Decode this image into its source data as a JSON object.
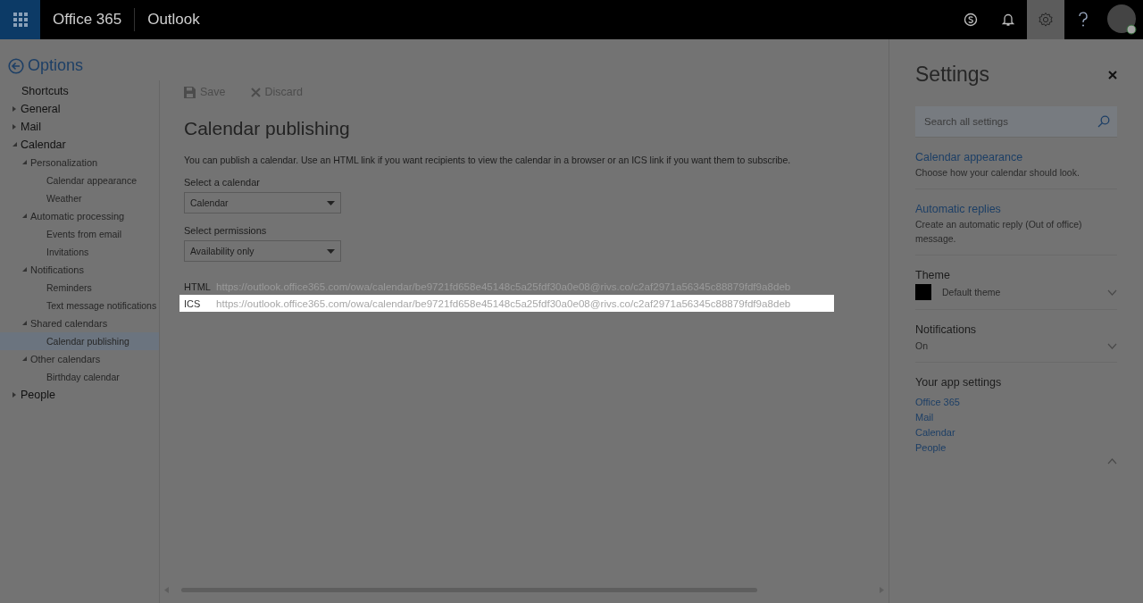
{
  "header": {
    "brand": "Office 365",
    "app": "Outlook",
    "icons": [
      {
        "kind": "skype",
        "selected": false
      },
      {
        "kind": "bell",
        "selected": false
      },
      {
        "kind": "settings",
        "selected": true
      },
      {
        "kind": "help",
        "selected": false
      },
      {
        "kind": "avatar",
        "selected": false
      }
    ]
  },
  "nav": {
    "title": "Options",
    "items": [
      {
        "label": "Shortcuts",
        "selected": false
      },
      {
        "label": "General",
        "expanded": false,
        "selected": false
      },
      {
        "label": "Mail",
        "expanded": false,
        "selected": false
      },
      {
        "label": "Calendar",
        "expanded": true,
        "selected": false,
        "children": [
          {
            "label": "Personalization",
            "expanded": true,
            "selected": false,
            "children": [
              {
                "label": "Calendar appearance",
                "selected": false
              },
              {
                "label": "Weather",
                "selected": false
              }
            ]
          },
          {
            "label": "Automatic processing",
            "expanded": true,
            "selected": false,
            "children": [
              {
                "label": "Events from email",
                "selected": false
              },
              {
                "label": "Invitations",
                "selected": false
              }
            ]
          },
          {
            "label": "Notifications",
            "expanded": true,
            "selected": false,
            "children": [
              {
                "label": "Reminders",
                "selected": false
              },
              {
                "label": "Text message notifications",
                "selected": false
              }
            ]
          },
          {
            "label": "Shared calendars",
            "expanded": true,
            "selected": false,
            "children": [
              {
                "label": "Calendar publishing",
                "selected": true
              }
            ]
          },
          {
            "label": "Other calendars",
            "expanded": true,
            "selected": false,
            "children": [
              {
                "label": "Birthday calendar",
                "selected": false
              }
            ]
          }
        ]
      },
      {
        "label": "People",
        "expanded": false,
        "selected": false
      }
    ]
  },
  "toolbar": [
    {
      "kind": "save",
      "label": "Save"
    },
    {
      "kind": "discard",
      "label": "Discard"
    }
  ],
  "page": {
    "title": "Calendar publishing",
    "description": "You can publish a calendar. Use an HTML link if you want recipients to view the calendar in a browser or an ICS link if you want them to subscribe.",
    "fields": [
      {
        "label": "Select a calendar",
        "value": "Calendar"
      },
      {
        "label": "Select permissions",
        "value": "Availability only"
      }
    ],
    "links": [
      {
        "label": "HTML",
        "url": "https://outlook.office365.com/owa/calendar/be9721fd658e45148c5a25fdf30a0e08@rivs.co/c2af2971a56345c88879fdf9a8deb",
        "selected": false
      },
      {
        "label": "ICS",
        "url": "https://outlook.office365.com/owa/calendar/be9721fd658e45148c5a25fdf30a0e08@rivs.co/c2af2971a56345c88879fdf9a8deb",
        "selected": true
      }
    ]
  },
  "settings": {
    "title": "Settings",
    "search": {
      "placeholder": "Search all settings"
    },
    "sections": [
      {
        "kind": "link",
        "title": "Calendar appearance",
        "text": "Choose how your calendar should look."
      },
      {
        "kind": "link",
        "title": "Automatic replies",
        "text": "Create an automatic reply (Out of office) message."
      },
      {
        "kind": "theme",
        "title": "Theme",
        "value": "Default theme",
        "color": "#000000"
      },
      {
        "kind": "dropdown",
        "title": "Notifications",
        "value": "On"
      },
      {
        "kind": "apps",
        "title": "Your app settings",
        "links": [
          "Office 365",
          "Mail",
          "Calendar",
          "People"
        ]
      }
    ]
  }
}
